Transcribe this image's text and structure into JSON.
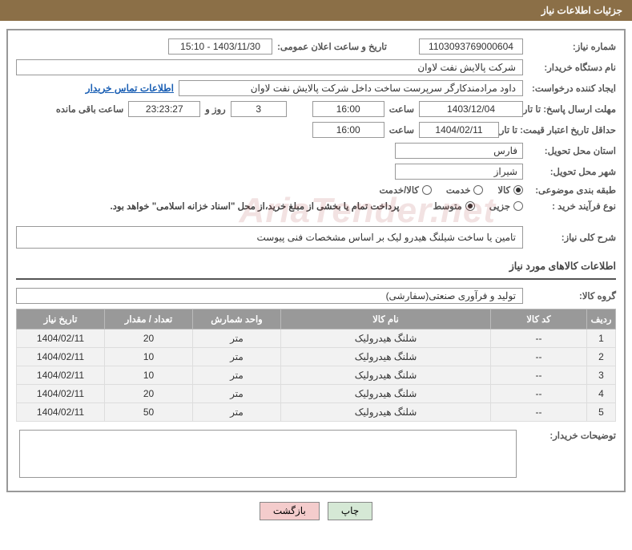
{
  "header": {
    "title": "جزئیات اطلاعات نیاز"
  },
  "labels": {
    "need_no": "شماره نیاز:",
    "announce_dt": "تاریخ و ساعت اعلان عمومی:",
    "org_name": "نام دستگاه خریدار:",
    "requester": "ایجاد کننده درخواست:",
    "contact_link": "اطلاعات تماس خریدار",
    "deadline": "مهلت ارسال پاسخ: تا تاریخ:",
    "hour": "ساعت",
    "days_and": "روز و",
    "remaining": "ساعت باقی مانده",
    "validity": "حداقل تاریخ اعتبار قیمت: تا تاریخ:",
    "province": "استان محل تحویل:",
    "city": "شهر محل تحویل:",
    "category": "طبقه بندی موضوعی:",
    "purchase_type": "نوع فرآیند خرید :",
    "desc_title": "شرح کلی نیاز:",
    "items_section": "اطلاعات کالاهای مورد نیاز",
    "group": "گروه کالا:",
    "buyer_notes": "توضیحات خریدار:"
  },
  "values": {
    "need_no": "1103093769000604",
    "announce_dt": "1403/11/30 - 15:10",
    "org_name": "شرکت پالایش نفت لاوان",
    "requester": "داود مرادمند‌کارگر سرپرست ساخت داخل شرکت پالایش نفت لاوان",
    "deadline_date": "1403/12/04",
    "deadline_time": "16:00",
    "remaining_days": "3",
    "remaining_hms": "23:23:27",
    "validity_date": "1404/02/11",
    "validity_time": "16:00",
    "province": "فارس",
    "city": "شیراز",
    "desc": "تامین یا ساخت شیلنگ هیدرو لیک بر اساس مشخصات فنی پیوست",
    "group": "تولید و فرآوری صنعتی(سفارشی)",
    "payment_note": "پرداخت تمام یا بخشی از مبلغ خرید،از محل \"اسناد خزانه اسلامی\" خواهد بود."
  },
  "radios": {
    "category": [
      {
        "label": "کالا",
        "checked": true
      },
      {
        "label": "خدمت",
        "checked": false
      },
      {
        "label": "کالا/خدمت",
        "checked": false
      }
    ],
    "purchase": [
      {
        "label": "جزیی",
        "checked": false
      },
      {
        "label": "متوسط",
        "checked": true
      }
    ]
  },
  "table": {
    "headers": [
      "ردیف",
      "کد کالا",
      "نام کالا",
      "واحد شمارش",
      "تعداد / مقدار",
      "تاریخ نیاز"
    ],
    "rows": [
      {
        "n": "1",
        "code": "--",
        "name": "شلنگ هیدرولیک",
        "unit": "متر",
        "qty": "20",
        "date": "1404/02/11"
      },
      {
        "n": "2",
        "code": "--",
        "name": "شلنگ هیدرولیک",
        "unit": "متر",
        "qty": "10",
        "date": "1404/02/11"
      },
      {
        "n": "3",
        "code": "--",
        "name": "شلنگ هیدرولیک",
        "unit": "متر",
        "qty": "10",
        "date": "1404/02/11"
      },
      {
        "n": "4",
        "code": "--",
        "name": "شلنگ هیدرولیک",
        "unit": "متر",
        "qty": "20",
        "date": "1404/02/11"
      },
      {
        "n": "5",
        "code": "--",
        "name": "شلنگ هیدرولیک",
        "unit": "متر",
        "qty": "50",
        "date": "1404/02/11"
      }
    ]
  },
  "buttons": {
    "print": "چاپ",
    "back": "بازگشت"
  },
  "watermark": "AriaTender.net"
}
